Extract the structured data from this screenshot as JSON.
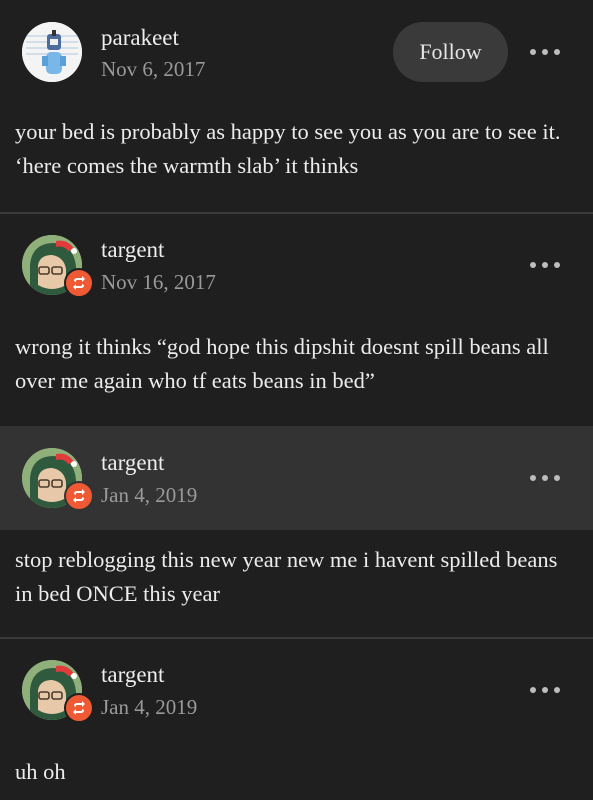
{
  "posts": [
    {
      "username": "parakeet",
      "date": "Nov 6, 2017",
      "follow_label": "Follow",
      "text": "your bed is probably as happy to see you as you are to see it. ‘here comes the warmth slab’ it thinks"
    },
    {
      "username": "targent",
      "date": "Nov 16, 2017",
      "text": "wrong it thinks “god hope this dipshit doesnt spill beans all over me again who tf eats beans in bed”"
    },
    {
      "username": "targent",
      "date": "Jan 4, 2019",
      "text": "stop reblogging this new year new me i havent spilled beans in bed ONCE this year"
    },
    {
      "username": "targent",
      "date": "Jan 4, 2019",
      "text": "uh oh"
    }
  ],
  "icons": {
    "more": "more-horizontal-icon",
    "reblog": "reblog-icon"
  },
  "colors": {
    "background": "#1f1f1f",
    "highlight": "#333333",
    "reblog_badge": "#ef5a35",
    "follow_button": "#3a3a3a"
  }
}
